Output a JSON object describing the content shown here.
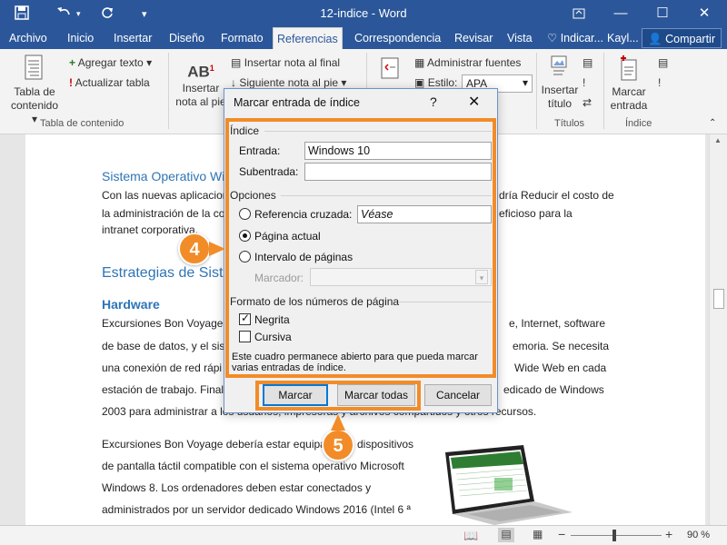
{
  "window": {
    "title": "12-indice - Word",
    "user": "Kayl...",
    "search": "Indicar...",
    "share": "Compartir"
  },
  "tabs": [
    "Archivo",
    "Inicio",
    "Insertar",
    "Diseño",
    "Formato",
    "Referencias",
    "Correspondencia",
    "Revisar",
    "Vista"
  ],
  "ribbon": {
    "toc_button": [
      "Tabla de",
      "contenido"
    ],
    "add_text": "Agregar texto",
    "update_table": "Actualizar tabla",
    "toc_group": "Tabla de contenido",
    "insert_footnote_big": [
      "Insertar",
      "nota al pie"
    ],
    "insert_endnote": "Insertar nota al final",
    "next_footnote": "Siguiente nota al pie",
    "manage_sources": "Administrar fuentes",
    "style_label": "Estilo:",
    "style_value": "APA",
    "insert_caption": [
      "Insertar",
      "título"
    ],
    "captions_group": "Títulos",
    "mark_entry": [
      "Marcar",
      "entrada"
    ],
    "index_group": "Índice"
  },
  "document": {
    "heading1": "Sistema Operativo Wi",
    "para1_line1_left": "Con las nuevas aplicacion",
    "para1_line1_right": "dría Reducir el costo de",
    "para1_line2_left": "la administración de la co",
    "para1_line2_right": "eficioso para la",
    "para1_line3": "intranet corporativa.",
    "heading2": "Estrategias de Sister",
    "heading3": "Hardware",
    "para2_line1_left": "Excursiones Bon Voyage (",
    "para2_line1_right": "e, Internet, software",
    "para2_line2_left": "de base de datos, y el sist",
    "para2_line2_right": "emoria. Se necesita",
    "para2_line3_left": "una conexión de red rápi",
    "para2_line3_right": "Wide Web en cada",
    "para2_line4_left": "estación de trabajo. Final",
    "para2_line4_right": "edicado de Windows",
    "para2_line5": "2003 para administrar a los usuarios, impresoras y archivos compartidos y otros recursos.",
    "para3_line1_left": "Excursiones Bon Voyage debería estar equipa",
    "para3_line1_right": "dispositivos",
    "para3_line2": "de pantalla táctil compatible con el sistema operativo Microsoft",
    "para3_line3": "Windows 8. Los ordenadores deben estar conectados y",
    "para3_line4": "administrados por un servidor dedicado Windows 2016 (Intel 6 ª"
  },
  "dialog": {
    "title": "Marcar entrada de índice",
    "help": "?",
    "close": "✕",
    "section_index": "Índice",
    "entry_label": "Entrada:",
    "entry_value": "Windows 10",
    "subentry_label": "Subentrada:",
    "subentry_value": "",
    "section_options": "Opciones",
    "opt_cross_ref": "Referencia cruzada:",
    "cross_ref_value": "Véase",
    "opt_current_page": "Página actual",
    "opt_page_range": "Intervalo de páginas",
    "bookmark_label": "Marcador:",
    "section_format": "Formato de los números de página",
    "bold_label": "Negrita",
    "italic_label": "Cursiva",
    "note": "Este cuadro permanece abierto para que pueda marcar varias entradas de índice.",
    "btn_mark": "Marcar",
    "btn_mark_all": "Marcar todas",
    "btn_cancel": "Cancelar",
    "selected_option": "current_page",
    "bold_checked": true,
    "italic_checked": false
  },
  "callouts": {
    "step4": "4",
    "step5": "5",
    "color": "#f28c28"
  },
  "statusbar": {
    "zoom": "90 %"
  },
  "colors": {
    "word_blue": "#2b579a",
    "heading_blue": "#2e75b6"
  }
}
